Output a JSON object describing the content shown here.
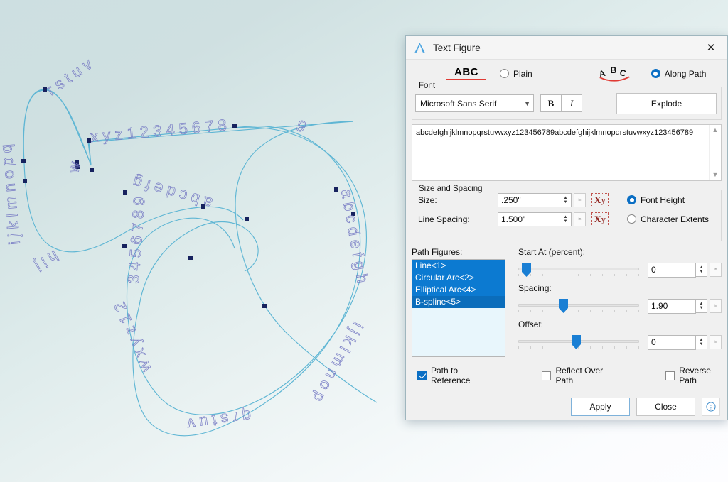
{
  "window": {
    "title": "Text Figure",
    "app_icon": "compass-logo-icon",
    "close_label": "✕"
  },
  "mode": {
    "plain_preview": "ABC",
    "plain_label": "Plain",
    "path_preview": "ABC",
    "path_label": "Along Path",
    "selected": "Along Path"
  },
  "font": {
    "group_label": "Font",
    "family": "Microsoft Sans Serif",
    "bold_label": "B",
    "italic_label": "I",
    "explode_label": "Explode"
  },
  "text_area": {
    "value": "abcdefghijklmnopqrstuvwxyz123456789abcdefghijklmnopqrstuvwxyz123456789",
    "scroll_up": "▲",
    "scroll_down": "▼"
  },
  "size_spacing": {
    "group_label": "Size and Spacing",
    "size_label": "Size:",
    "size_value": ".250\"",
    "line_spacing_label": "Line Spacing:",
    "line_spacing_value": "1.500\"",
    "xy_glyph_x": "X",
    "xy_glyph_y": "y",
    "font_height_label": "Font Height",
    "character_extents_label": "Character Extents",
    "selected_metric": "Font Height",
    "unit_button_label": "in"
  },
  "path_figures": {
    "label": "Path Figures:",
    "items": [
      {
        "name": "Line<1>",
        "selected": true,
        "focused": false
      },
      {
        "name": "Circular Arc<2>",
        "selected": true,
        "focused": false
      },
      {
        "name": "Elliptical Arc<4>",
        "selected": true,
        "focused": false
      },
      {
        "name": "B-spline<5>",
        "selected": true,
        "focused": true
      }
    ]
  },
  "sliders": [
    {
      "label": "Start At (percent):",
      "value": "0",
      "position_pct": 3
    },
    {
      "label": "Spacing:",
      "value": "1.90",
      "position_pct": 36
    },
    {
      "label": "Offset:",
      "value": "0",
      "position_pct": 48
    }
  ],
  "checkboxes": [
    {
      "label": "Path to Reference",
      "checked": true
    },
    {
      "label": "Reflect Over Path",
      "checked": false
    },
    {
      "label": "Reverse Path",
      "checked": false
    }
  ],
  "buttons": {
    "apply_label": "Apply",
    "close_label": "Close",
    "help_label": "?"
  },
  "colors": {
    "accent_blue": "#0b6fc4",
    "list_selection": "#0c7ad1",
    "list_focus": "#0b6dbb",
    "list_background": "#e8f6fc",
    "red_underline": "#e03a34",
    "xy_red": "#8e1f1a",
    "dialog_background": "#f0f0f0",
    "canvas_top": "#cddfe1",
    "canvas_bottom": "#fdfdff",
    "curve_stroke": "#5fb6d4",
    "glyph_stroke": "#6b6fbf",
    "control_point": "#1b2a6b"
  },
  "canvas": {
    "glyph_text": "abcdefghijklmnopqrstuvwxyz123456789abcdefghijklmnopqrstuvwxyz123456789",
    "figure_names": [
      "Line<1>",
      "Circular Arc<2>",
      "Elliptical Arc<4>",
      "B-spline<5>"
    ]
  }
}
